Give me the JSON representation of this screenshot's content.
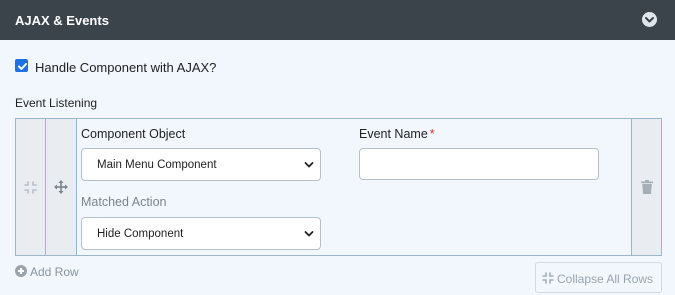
{
  "panel": {
    "title": "AJAX & Events"
  },
  "ajax_option": {
    "label": "Handle Component with AJAX?",
    "checked": true
  },
  "event_listening": {
    "label": "Event Listening",
    "rows": [
      {
        "component_object_label": "Component Object",
        "component_object_value": "Main Menu Component",
        "event_name_label": "Event Name",
        "event_name_required_marker": "*",
        "event_name_value": "",
        "matched_action_label": "Matched Action",
        "matched_action_value": "Hide Component"
      }
    ],
    "add_row_label": "Add Row",
    "collapse_all_label": "Collapse All Rows"
  },
  "colors": {
    "header_bg": "#3b434b",
    "panel_bg": "#f1f7fc",
    "accent": "#1a73e8",
    "border": "#9bb7cc",
    "required": "#d0312d"
  },
  "icons": {
    "header_toggle": "chevron-down-circle-icon",
    "drag_handle": "compress-arrows-icon",
    "move_handle": "move-arrows-icon",
    "delete": "trash-icon",
    "add": "plus-circle-icon",
    "select_caret": "chevron-down-icon"
  }
}
